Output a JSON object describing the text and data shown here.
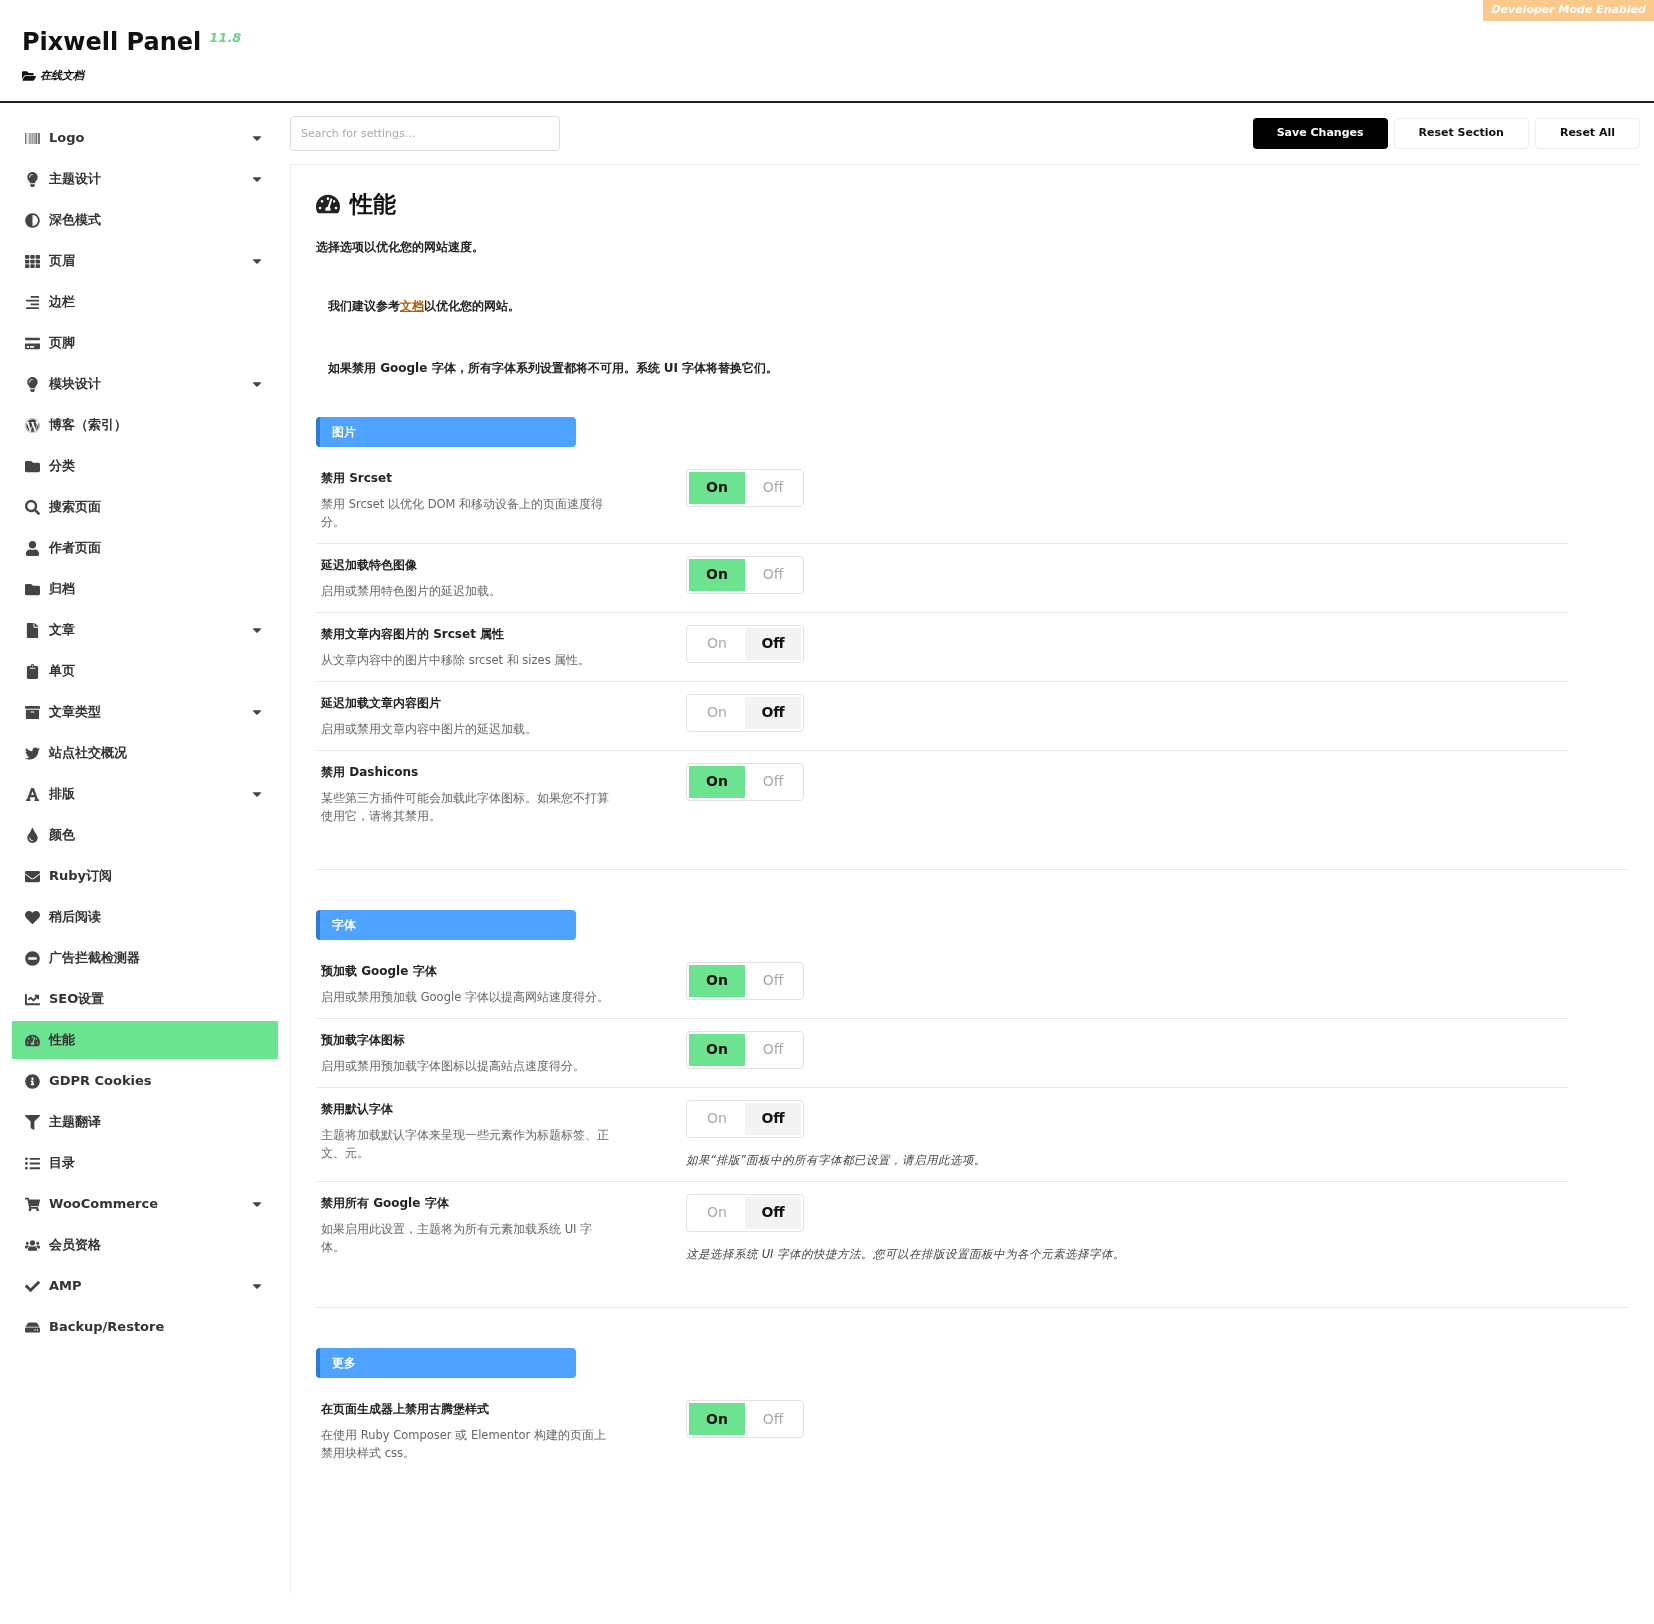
{
  "header": {
    "title": "Pixwell Panel",
    "version": "11.8",
    "docs_link": "在线文档",
    "badge": "Developer Mode Enabled"
  },
  "sidebar": {
    "items": [
      {
        "label": "Logo",
        "has_submenu": true,
        "selected": false
      },
      {
        "label": "主题设计",
        "has_submenu": true,
        "selected": false
      },
      {
        "label": "深色模式",
        "has_submenu": false,
        "selected": false
      },
      {
        "label": "页眉",
        "has_submenu": true,
        "selected": false
      },
      {
        "label": "边栏",
        "has_submenu": false,
        "selected": false
      },
      {
        "label": "页脚",
        "has_submenu": false,
        "selected": false
      },
      {
        "label": "模块设计",
        "has_submenu": true,
        "selected": false
      },
      {
        "label": "博客（索引）",
        "has_submenu": false,
        "selected": false
      },
      {
        "label": "分类",
        "has_submenu": false,
        "selected": false
      },
      {
        "label": "搜索页面",
        "has_submenu": false,
        "selected": false
      },
      {
        "label": "作者页面",
        "has_submenu": false,
        "selected": false
      },
      {
        "label": "归档",
        "has_submenu": false,
        "selected": false
      },
      {
        "label": "文章",
        "has_submenu": true,
        "selected": false
      },
      {
        "label": "单页",
        "has_submenu": false,
        "selected": false
      },
      {
        "label": "文章类型",
        "has_submenu": true,
        "selected": false
      },
      {
        "label": "站点社交概况",
        "has_submenu": false,
        "selected": false
      },
      {
        "label": "排版",
        "has_submenu": true,
        "selected": false
      },
      {
        "label": "颜色",
        "has_submenu": false,
        "selected": false
      },
      {
        "label": "Ruby订阅",
        "has_submenu": false,
        "selected": false
      },
      {
        "label": "稍后阅读",
        "has_submenu": false,
        "selected": false
      },
      {
        "label": "广告拦截检测器",
        "has_submenu": false,
        "selected": false
      },
      {
        "label": "SEO设置",
        "has_submenu": false,
        "selected": false
      },
      {
        "label": "性能",
        "has_submenu": false,
        "selected": true
      },
      {
        "label": "GDPR Cookies",
        "has_submenu": false,
        "selected": false
      },
      {
        "label": "主题翻译",
        "has_submenu": false,
        "selected": false
      },
      {
        "label": "目录",
        "has_submenu": false,
        "selected": false
      },
      {
        "label": "WooCommerce",
        "has_submenu": true,
        "selected": false
      },
      {
        "label": "会员资格",
        "has_submenu": false,
        "selected": false
      },
      {
        "label": "AMP",
        "has_submenu": true,
        "selected": false
      },
      {
        "label": "Backup/Restore",
        "has_submenu": false,
        "selected": false
      }
    ]
  },
  "toolbar": {
    "search": {
      "placeholder": "Search for settings..."
    },
    "buttons": [
      "Save Changes",
      "Reset Section",
      "Reset All"
    ]
  },
  "panel": {
    "title": "性能",
    "subtitle": "选择选项以优化您的网站速度。",
    "notice": {
      "before": "我们建议参考",
      "link": "文档",
      "after": "以优化您的网站。"
    },
    "info": "如果禁用 Google 字体，所有字体系列设置都将不可用。系统 UI 字体将替换它们。",
    "sections": [
      {
        "title": "图片",
        "settings": [
          {
            "title": "禁用 Srcset",
            "description": "禁用 Srcset 以优化 DOM 和移动设备上的页面速度得分。",
            "on": true,
            "on_label": "On",
            "off_label": "Off"
          },
          {
            "title": "延迟加载特色图像",
            "description": "启用或禁用特色图片的延迟加载。",
            "on": true,
            "on_label": "On",
            "off_label": "Off"
          },
          {
            "title": "禁用文章内容图片的 Srcset 属性",
            "description": "从文章内容中的图片中移除 srcset 和 sizes 属性。",
            "on": false,
            "on_label": "On",
            "off_label": "Off"
          },
          {
            "title": "延迟加载文章内容图片",
            "description": "启用或禁用文章内容中图片的延迟加载。",
            "on": false,
            "on_label": "On",
            "off_label": "Off"
          },
          {
            "title": "禁用 Dashicons",
            "description": "某些第三方插件可能会加载此字体图标。如果您不打算使用它，请将其禁用。",
            "on": true,
            "on_label": "On",
            "off_label": "Off"
          }
        ]
      },
      {
        "title": "字体",
        "settings": [
          {
            "title": "预加载 Google 字体",
            "description": "启用或禁用预加载 Google 字体以提高网站速度得分。",
            "on": true,
            "on_label": "On",
            "off_label": "Off"
          },
          {
            "title": "预加载字体图标",
            "description": "启用或禁用预加载字体图标以提高站点速度得分。",
            "on": true,
            "on_label": "On",
            "off_label": "Off"
          },
          {
            "title": "禁用默认字体",
            "description": "主题将加载默认字体来呈现一些元素作为标题标签、正文、元。",
            "on": false,
            "on_label": "On",
            "off_label": "Off",
            "note": "如果“排版”面板中的所有字体都已设置，请启用此选项。"
          },
          {
            "title": "禁用所有 Google 字体",
            "description": "如果启用此设置，主题将为所有元素加载系统 UI 字体。",
            "on": false,
            "on_label": "On",
            "off_label": "Off",
            "note": "这是选择系统 UI 字体的快捷方法。您可以在排版设置面板中为各个元素选择字体。"
          }
        ]
      },
      {
        "title": "更多",
        "settings": [
          {
            "title": "在页面生成器上禁用古腾堡样式",
            "description": "在使用 Ruby Composer 或 Elementor 构建的页面上禁用块样式 css。",
            "on": true,
            "on_label": "On",
            "off_label": "Off"
          }
        ]
      }
    ]
  }
}
